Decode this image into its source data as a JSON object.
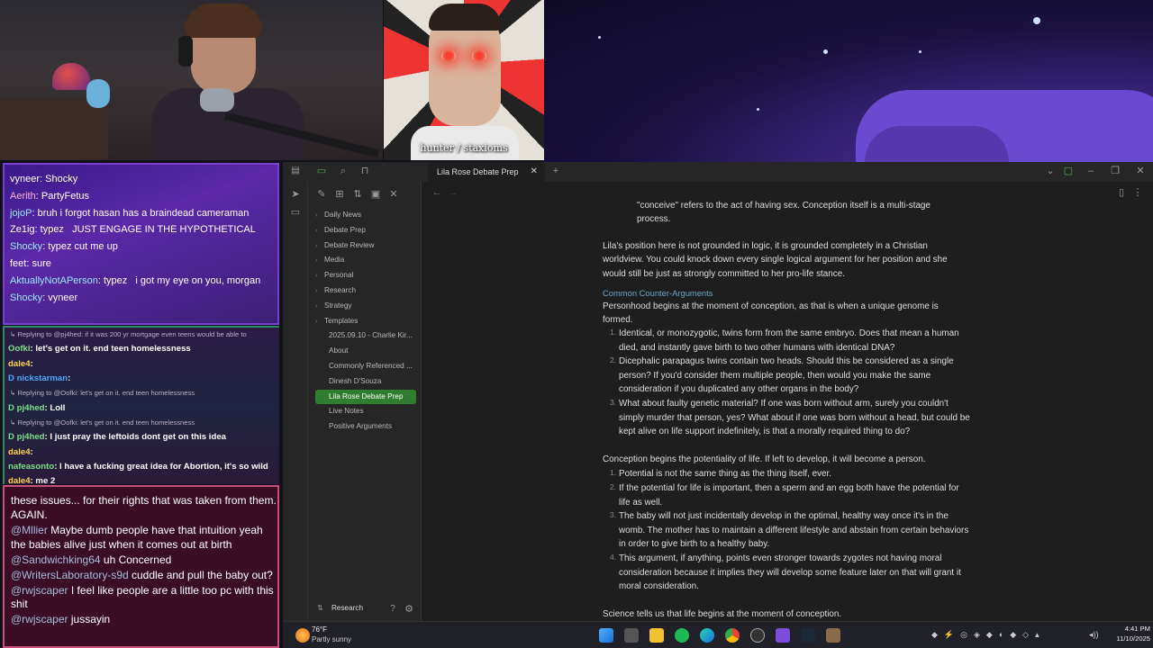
{
  "guest_caption": "hunter / staxioms",
  "chat_top": [
    {
      "user": "vyneer",
      "user_color": "#ffffff",
      "text": ": Shocky"
    },
    {
      "user": "Aerith",
      "user_color": "#ffb0d8",
      "text": ": PartyFetus"
    },
    {
      "user": "jojoP",
      "user_color": "#9be8ff",
      "text": ": bruh i forgot hasan has a braindead cameraman"
    },
    {
      "user": "Ze1ig",
      "user_color": "#ffffff",
      "text": ": typez   JUST ENGAGE IN THE HYPOTHETICAL"
    },
    {
      "user": "Shocky",
      "user_color": "#9be8ff",
      "text": ": typez cut me up"
    },
    {
      "user": "feet",
      "user_color": "#ffffff",
      "text": ": sure"
    },
    {
      "user": "AktuallyNotAPerson",
      "user_color": "#9be8ff",
      "text": ": typez   i got my eye on you, morgan"
    },
    {
      "user": "Shocky",
      "user_color": "#9be8ff",
      "text": ": vyneer"
    }
  ],
  "chat_mid": [
    {
      "kind": "reply",
      "text": "↳ Replying to @pj4hed: if it was 200 yr mortgage even teens would be able to"
    },
    {
      "kind": "msg",
      "user": "Oofki",
      "user_color": "#7be08a",
      "text": ": let's get on it. end teen homelessness"
    },
    {
      "kind": "msg",
      "user": "dale4",
      "user_color": "#ffd24a",
      "text": ":"
    },
    {
      "kind": "msg",
      "user": "D nickstarman",
      "user_color": "#4aa8ff",
      "text": ":"
    },
    {
      "kind": "reply",
      "text": "↳ Replying to @Oofki: let's get on it. end teen homelessness"
    },
    {
      "kind": "msg",
      "user": "D pj4hed",
      "user_color": "#7be08a",
      "text": ": Loll"
    },
    {
      "kind": "reply",
      "text": "↳ Replying to @Oofki: let's get on it. end teen homelessness"
    },
    {
      "kind": "msg",
      "user": "D pj4hed",
      "user_color": "#7be08a",
      "text": ": I just pray the leftoids dont get on this idea"
    },
    {
      "kind": "msg",
      "user": "dale4",
      "user_color": "#ffd24a",
      "text": ":"
    },
    {
      "kind": "msg",
      "user": "nafeasonto",
      "user_color": "#7be08a",
      "text": ": I have a fucking great idea for Abortion, it's so wild"
    },
    {
      "kind": "msg",
      "user": "dale4",
      "user_color": "#ffd24a",
      "text": ": me 2"
    }
  ],
  "chat_bottom": [
    {
      "user": "",
      "text": "these issues... for their rights that was taken from them. AGAIN."
    },
    {
      "user": "@Mllier",
      "text": " Maybe dumb people have that intuition yeah the babies alive just when it comes out at birth"
    },
    {
      "user": "@Sandwichking64",
      "text": " uh Concerned"
    },
    {
      "user": "@WritersLaboratory-s9d",
      "text": " cuddle and pull the baby out?"
    },
    {
      "user": "@rwjscaper",
      "text": " I feel like people are a little too pc with this shit"
    },
    {
      "user": "@rwjscaper",
      "text": " jussayin"
    }
  ],
  "obsidian": {
    "tab_title": "Lila Rose Debate Prep",
    "folders": [
      "Daily News",
      "Debate Prep",
      "Debate Review",
      "Media",
      "Personal",
      "Research",
      "Strategy",
      "Templates"
    ],
    "files": [
      "2025.09.10 - Charlie Kir...",
      "About",
      "Commonly Referenced ...",
      "Dinesh D'Souza",
      "Lila Rose Debate Prep",
      "Live Notes",
      "Positive Arguments"
    ],
    "active_file": "Lila Rose Debate Prep",
    "vault_name": "Research",
    "top_fragment": "\"conceive\" refers to the act of having sex. Conception itself is a multi-stage process.",
    "para1": "Lila's position here is not grounded in logic, it is grounded completely in a Christian worldview. You could knock down every single logical argument for her position and she would still be just as strongly committed to her pro-life stance.",
    "heading": "Common Counter-Arguments",
    "para2": "Personhood begins at the moment of conception, as that is when a unique genome is formed.",
    "list1": [
      "Identical, or monozygotic, twins form from the same embryo. Does that mean a human died, and instantly gave birth to two other humans with identical DNA?",
      "Dicephalic parapagus twins contain two heads. Should this be considered as a single person? If you'd consider them multiple people, then would you make the same consideration if you duplicated any other organs in the body?",
      "What about faulty genetic material? If one was born without arm, surely you couldn't simply murder that person, yes? What about if one was born without a head, but could be kept alive on life support indefinitely, is that a morally required thing to do?"
    ],
    "para3": "Conception begins the potentiality of life. If left to develop, it will become a person.",
    "list2": [
      "Potential is not the same thing as the thing itself, ever.",
      "If the potential for life is important, then a sperm and an egg both have the potential for life as well.",
      "The baby will not just incidentally develop in the optimal, healthy way once it's in the womb. The mother has to maintain a different lifestyle and abstain from certain behaviors in order to give birth to a healthy baby.",
      "This argument, if anything, points even stronger towards zygotes not having moral consideration because it implies they will develop some feature later on that will grant it moral consideration."
    ],
    "para4": "Science tells us that life begins at the moment of conception."
  },
  "taskbar": {
    "temperature": "76°F",
    "weather": "Partly sunny",
    "time": "4:41 PM",
    "date": "11/10/2025"
  },
  "colors": {
    "accent_green": "#2f7d2f",
    "heading_blue": "#6aa5c8",
    "chat_purple": "#5b28a8"
  }
}
